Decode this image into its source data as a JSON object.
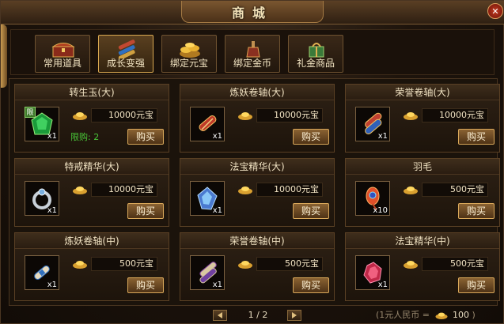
{
  "window": {
    "title": "商城",
    "close_icon": "close-icon"
  },
  "tabs": [
    {
      "label": "常用道具",
      "icon": "treasure-chest-icon",
      "active": false
    },
    {
      "label": "成长变强",
      "icon": "scroll-bundle-icon",
      "active": true
    },
    {
      "label": "绑定元宝",
      "icon": "ingot-pile-icon",
      "active": false
    },
    {
      "label": "绑定金币",
      "icon": "potion-bottle-icon",
      "active": false
    },
    {
      "label": "礼金商品",
      "icon": "gift-bag-icon",
      "active": false
    }
  ],
  "items": [
    {
      "name": "转生玉(大)",
      "price": "10000元宝",
      "qty": "x1",
      "icon": "green-jade-icon",
      "tag": "限",
      "limit": "限购: 2",
      "buy": "购买"
    },
    {
      "name": "炼妖卷轴(大)",
      "price": "10000元宝",
      "qty": "x1",
      "icon": "red-scroll-icon",
      "buy": "购买"
    },
    {
      "name": "荣誉卷轴(大)",
      "price": "10000元宝",
      "qty": "x1",
      "icon": "blue-scroll-icon",
      "buy": "购买"
    },
    {
      "name": "特戒精华(大)",
      "price": "10000元宝",
      "qty": "x1",
      "icon": "silver-ring-icon",
      "buy": "购买"
    },
    {
      "name": "法宝精华(大)",
      "price": "10000元宝",
      "qty": "x1",
      "icon": "blue-crystal-icon",
      "buy": "购买"
    },
    {
      "name": "羽毛",
      "price": "500元宝",
      "qty": "x10",
      "icon": "feather-icon",
      "buy": "购买"
    },
    {
      "name": "炼妖卷轴(中)",
      "price": "500元宝",
      "qty": "x1",
      "icon": "small-scroll-icon",
      "buy": "购买"
    },
    {
      "name": "荣誉卷轴(中)",
      "price": "500元宝",
      "qty": "x1",
      "icon": "purple-scroll-icon",
      "buy": "购买"
    },
    {
      "name": "法宝精华(中)",
      "price": "500元宝",
      "qty": "x1",
      "icon": "red-crystal-icon",
      "buy": "购买"
    }
  ],
  "pager": {
    "text": "1 / 2"
  },
  "exchange": {
    "prefix": "(1元人民币 =",
    "value": "100",
    "suffix": ")"
  },
  "colors": {
    "accent_gold": "#d9a85a",
    "limit_green": "#49c638",
    "text": "#f0e2c2"
  }
}
